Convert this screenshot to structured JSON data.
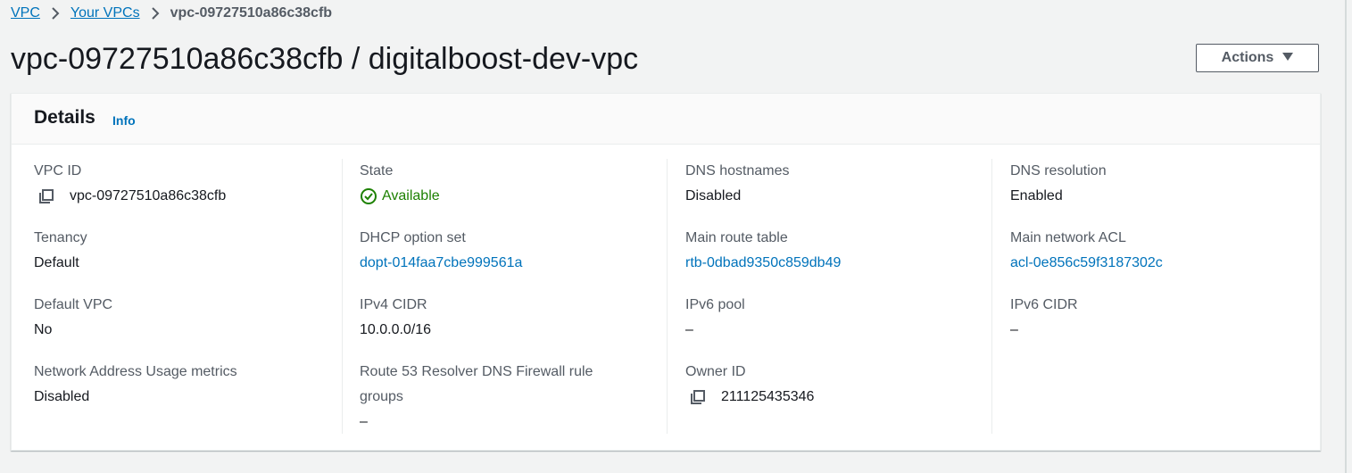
{
  "breadcrumb": {
    "items": [
      "VPC",
      "Your VPCs"
    ],
    "current": "vpc-09727510a86c38cfb"
  },
  "page_title": "vpc-09727510a86c38cfb / digitalboost-dev-vpc",
  "actions_label": "Actions",
  "details": {
    "title": "Details",
    "info_label": "Info",
    "columns": [
      [
        {
          "label": "VPC ID",
          "value": "vpc-09727510a86c38cfb"
        },
        {
          "label": "Tenancy",
          "value": "Default"
        },
        {
          "label": "Default VPC",
          "value": "No"
        },
        {
          "label": "Network Address Usage metrics",
          "value": "Disabled"
        }
      ],
      [
        {
          "label": "State",
          "value": "Available"
        },
        {
          "label": "DHCP option set",
          "value": "dopt-014faa7cbe999561a"
        },
        {
          "label": "IPv4 CIDR",
          "value": "10.0.0.0/16"
        },
        {
          "label_line1": "Route 53 Resolver DNS Firewall rule",
          "label_line2": "groups",
          "value": "–"
        }
      ],
      [
        {
          "label": "DNS hostnames",
          "value": "Disabled"
        },
        {
          "label": "Main route table",
          "value": "rtb-0dbad9350c859db49"
        },
        {
          "label": "IPv6 pool",
          "value": "–"
        },
        {
          "label": "Owner ID",
          "value": "211125435346"
        }
      ],
      [
        {
          "label": "DNS resolution",
          "value": "Enabled"
        },
        {
          "label": "Main network ACL",
          "value": "acl-0e856c59f3187302c"
        },
        {
          "label": "IPv6 CIDR",
          "value": "–"
        }
      ]
    ]
  },
  "colors": {
    "link": "#0073bb",
    "status_ok": "#1d8102",
    "label": "#545b64",
    "text": "#16191f"
  },
  "icons": [
    "chevron-right-icon",
    "caret-down-icon",
    "copy-icon",
    "status-ok-icon"
  ]
}
